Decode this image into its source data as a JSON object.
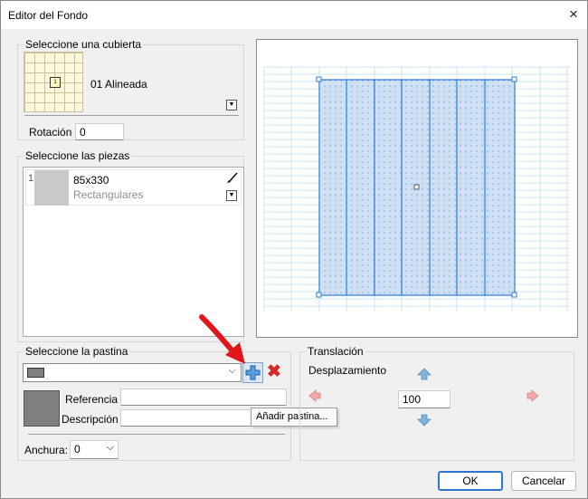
{
  "window": {
    "title": "Editor del Fondo",
    "close_glyph": "×"
  },
  "cubierta": {
    "group_label": "Seleccione una cubierta",
    "selected_name": "01 Alineada",
    "thumb_label": "1",
    "rotation_label": "Rotación",
    "rotation_value": "0"
  },
  "piezas": {
    "group_label": "Seleccione las piezas",
    "items": [
      {
        "index": "1",
        "size": "85x330",
        "type": "Rectangulares"
      }
    ]
  },
  "pastina": {
    "group_label": "Seleccione la pastina",
    "selected_value": "",
    "referencia_label": "Referencia",
    "referencia_value": "",
    "descripcion_label": "Descripción",
    "descripcion_value": "",
    "anchura_label": "Anchura:",
    "anchura_value": "0",
    "tooltip": "Añadir pastina...",
    "swatch_color": "#7f7f7f"
  },
  "traslacion": {
    "group_label": "Translación",
    "desplazamiento_label": "Desplazamiento",
    "value": "100"
  },
  "buttons": {
    "ok": "OK",
    "cancel": "Cancelar"
  },
  "colors": {
    "accent": "#2f75d0",
    "tile_fill": "#cfe0f4",
    "tile_line": "#2b7bd6",
    "grid_line": "#a9d4f0",
    "delete_red": "#d9262a",
    "annotation_red": "#e0161a"
  }
}
